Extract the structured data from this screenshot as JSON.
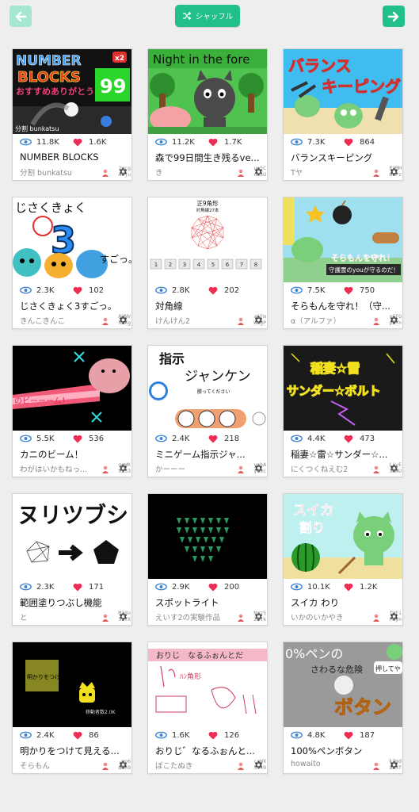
{
  "nav": {
    "shuffle_label": "シャッフル",
    "back_icon": "arrow-left-icon",
    "forward_icon": "arrow-right-icon",
    "shuffle_icon": "shuffle-icon"
  },
  "colors": {
    "accent": "#21c08b",
    "accent_disabled": "#a6e8cf",
    "heart": "#ef2d54",
    "eye": "#3c83d6"
  },
  "thumb_text": {
    "nb1": "NUMBER",
    "nb2": "BLOCKS",
    "nb3": "おすすめありがとう",
    "nb4": "99",
    "nb5": "分割 bunkatsu",
    "nb6": "x2",
    "f1": "Night in the fore",
    "b1": "バランス",
    "b2": "キーピング",
    "j1": "じさくきょく",
    "j2": "3",
    "j3": "すごっ。",
    "t1": "正9角形",
    "t2": "対角線27本",
    "tnums": [
      "1",
      "2",
      "3",
      "4",
      "5",
      "6",
      "7",
      "8"
    ],
    "s1": "そらもんを守れ！",
    "s2": "守護霊のyouが守るのだ！",
    "k1": "のビーーーム！",
    "m1": "指示",
    "m2": "ジャンケン",
    "m3": "勝ってください",
    "i1": "稲妻☆雷",
    "i2": "サンダー☆ボルト",
    "h1": "ヌリツブシ",
    "w1": "スイカ",
    "w2": "割り",
    "a1": "明かりをつけて",
    "a2": "移動者数2.0K",
    "o1": "おりじ　なるふぉんとだ",
    "o2": "ﾊﾝ角形",
    "p1": "0%ペンの",
    "p2": "さわるな危険",
    "p3": "ボタン",
    "p4": "押してや"
  },
  "cards": [
    {
      "views": "11.8K",
      "likes": "1.6K",
      "title": "NUMBER BLOCKS",
      "author": "分割 bunkatsu",
      "uid1": "2ecg",
      "uid2": "APju"
    },
    {
      "views": "11.2K",
      "likes": "1.7K",
      "title": "森で99日間生き残るve...",
      "author": "き",
      "uid1": "uo5C",
      "uid2": "nh5U"
    },
    {
      "views": "7.3K",
      "likes": "864",
      "title": "バランスキーピング",
      "author": "Tヤ",
      "uid1": "PJMH",
      "uid2": "muPz"
    },
    {
      "views": "2.3K",
      "likes": "102",
      "title": "じさくきょく3すごっ。",
      "author": "きんこきんこ",
      "uid1": "AHNV",
      "uid2": "RLXg"
    },
    {
      "views": "2.8K",
      "likes": "202",
      "title": "対角線",
      "author": "けんけん2",
      "uid1": "a6Fm",
      "uid2": "WXgP"
    },
    {
      "views": "7.5K",
      "likes": "750",
      "title": "そらもんを守れ！（守...",
      "author": "α（アルファ）",
      "uid1": "xGFQ",
      "uid2": "pZYn"
    },
    {
      "views": "5.5K",
      "likes": "536",
      "title": "カニのビーム！",
      "author": "わがはいかもねっ...",
      "uid1": "qgWK",
      "uid2": "9933"
    },
    {
      "views": "2.4K",
      "likes": "218",
      "title": "ミニゲーム指示ジャ...",
      "author": "かーーー",
      "uid1": "yshA",
      "uid2": "y19c"
    },
    {
      "views": "4.4K",
      "likes": "473",
      "title": "稲妻☆雷☆サンダー☆...",
      "author": "にくつくねえむ2",
      "uid1": "LjyE",
      "uid2": "3RNU"
    },
    {
      "views": "2.3K",
      "likes": "171",
      "title": "範囲塗りつぶし機能",
      "author": "と",
      "uid1": "M2do",
      "uid2": "3zYX"
    },
    {
      "views": "2.9K",
      "likes": "200",
      "title": "スポットライト",
      "author": "えいす2の実験作品",
      "uid1": "Nzz5",
      "uid2": "ZEtk"
    },
    {
      "views": "10.1K",
      "likes": "1.2K",
      "title": "スイカ わり",
      "author": "いかのいかやき",
      "uid1": "fHFi",
      "uid2": "FKyn"
    },
    {
      "views": "2.4K",
      "likes": "86",
      "title": "明かりをつけて見える...",
      "author": "そらもん",
      "uid1": "-qp6",
      "uid2": "BRn9"
    },
    {
      "views": "1.6K",
      "likes": "126",
      "title": "おりじ゛なるふぉんと...",
      "author": "ぽこたぬき",
      "uid1": "crWX",
      "uid2": "5Y49"
    },
    {
      "views": "4.8K",
      "likes": "187",
      "title": "100%ペンボタン",
      "author": "howaito",
      "uid1": "kZmd",
      "uid2": "ab3f"
    }
  ]
}
